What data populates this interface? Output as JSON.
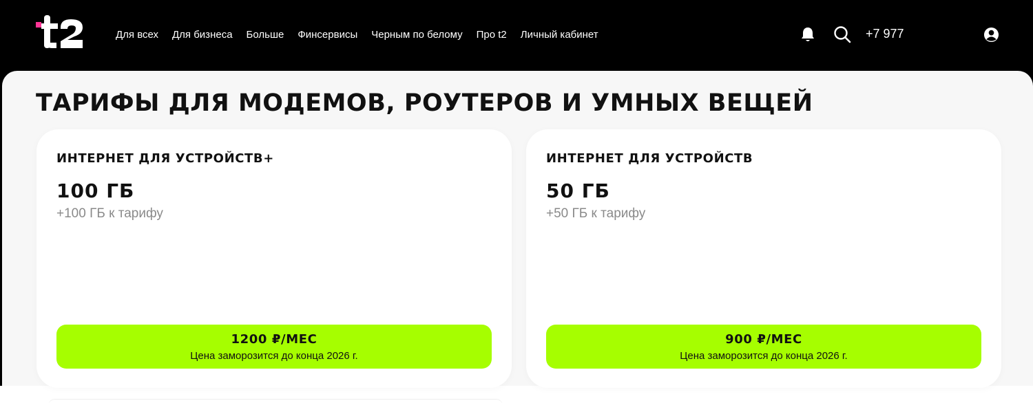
{
  "header": {
    "logo_text": "t2",
    "nav": [
      "Для всех",
      "Для бизнеса",
      "Больше",
      "Финсервисы",
      "Черным по белому",
      "Про t2",
      "Личный кабинет"
    ],
    "phone": "+7 977",
    "icons": [
      "bell-icon",
      "search-icon",
      "user-icon"
    ]
  },
  "page": {
    "title": "ТАРИФЫ ДЛЯ МОДЕМОВ, РОУТЕРОВ И УМНЫХ ВЕЩЕЙ"
  },
  "cards": [
    {
      "title": "ИНТЕРНЕТ ДЛЯ УСТРОЙСТВ+",
      "volume": "100 ГБ",
      "subtitle": "+100 ГБ к тарифу",
      "price": "1200 ₽/МЕС",
      "price_note": "Цена заморозится до конца 2026 г."
    },
    {
      "title": "ИНТЕРНЕТ ДЛЯ УСТРОЙСТВ",
      "volume": "50 ГБ",
      "subtitle": "+50 ГБ к тарифу",
      "price": "900 ₽/МЕС",
      "price_note": "Цена заморозится до конца 2026 г."
    }
  ],
  "colors": {
    "accent": "#a6fe00",
    "logo_accent": "#ff3495",
    "header_bg": "#000000",
    "page_bg": "#f7f7f7"
  }
}
